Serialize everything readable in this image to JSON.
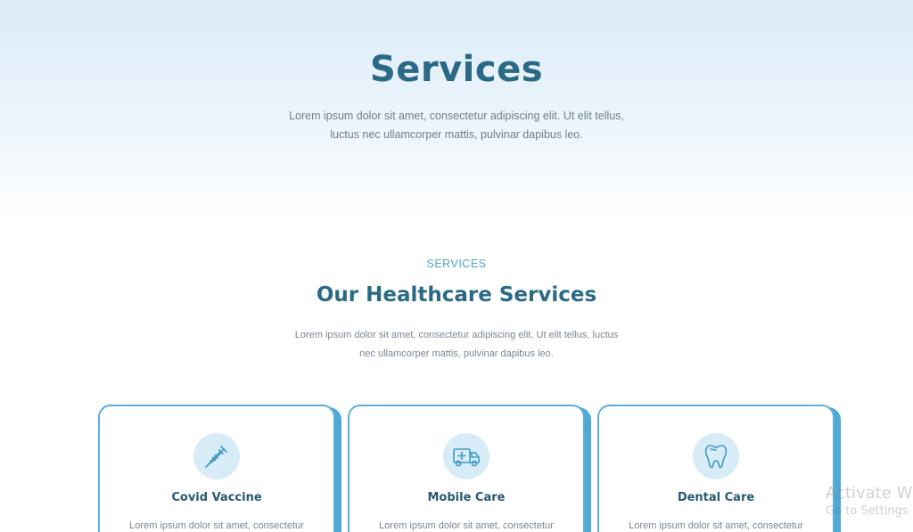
{
  "hero": {
    "title": "Services",
    "desc_line1": "Lorem ipsum dolor sit amet, consectetur adipiscing elit. Ut elit tellus,",
    "desc_line2": "luctus nec ullamcorper mattis, pulvinar dapibus leo."
  },
  "section": {
    "eyebrow": "SERVICES",
    "title": "Our Healthcare Services",
    "desc_line1": "Lorem ipsum dolor sit amet, consectetur adipiscing elit. Ut elit tellus, luctus",
    "desc_line2": "nec ullamcorper mattis, pulvinar dapibus leo."
  },
  "cards": [
    {
      "title": "Covid Vaccine",
      "icon": "syringe-icon",
      "text": "Lorem ipsum dolor sit amet, consectetur"
    },
    {
      "title": "Mobile Care",
      "icon": "ambulance-icon",
      "text": "Lorem ipsum dolor sit amet, consectetur"
    },
    {
      "title": "Dental Care",
      "icon": "tooth-icon",
      "text": "Lorem ipsum dolor sit amet, consectetur"
    }
  ],
  "watermark": {
    "line1": "Activate Wi",
    "line2": "Go to Settings"
  },
  "colors": {
    "primary": "#2a6a86",
    "accent": "#4fa3cc",
    "card_border": "#5bb0da",
    "icon_bg": "#d8ecf7"
  }
}
